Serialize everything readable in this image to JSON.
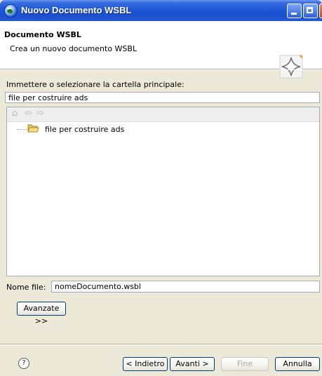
{
  "window": {
    "title": "Nuovo Documento WSBL"
  },
  "header": {
    "title": "Documento WSBL",
    "description": "Crea un nuovo documento WSBL"
  },
  "folder": {
    "prompt": "Immettere o selezionare la cartella principale:",
    "value": "file per costruire ads",
    "tree_items": [
      {
        "label": "file per costruire ads"
      }
    ]
  },
  "file": {
    "label": "Nome file:",
    "value": "nomeDocumento.wsbl"
  },
  "buttons": {
    "advanced": "Avanzate >>",
    "back": "< Indietro",
    "next": "Avanti >",
    "finish": "Fine",
    "cancel": "Annulla"
  },
  "help": {
    "glyph": "?"
  },
  "icons": {
    "app": "globe-icon",
    "home": "home-icon",
    "back": "arrow-left-icon",
    "forward": "arrow-right-icon",
    "folder": "open-folder-icon",
    "wizard": "diamond-star-icon"
  }
}
